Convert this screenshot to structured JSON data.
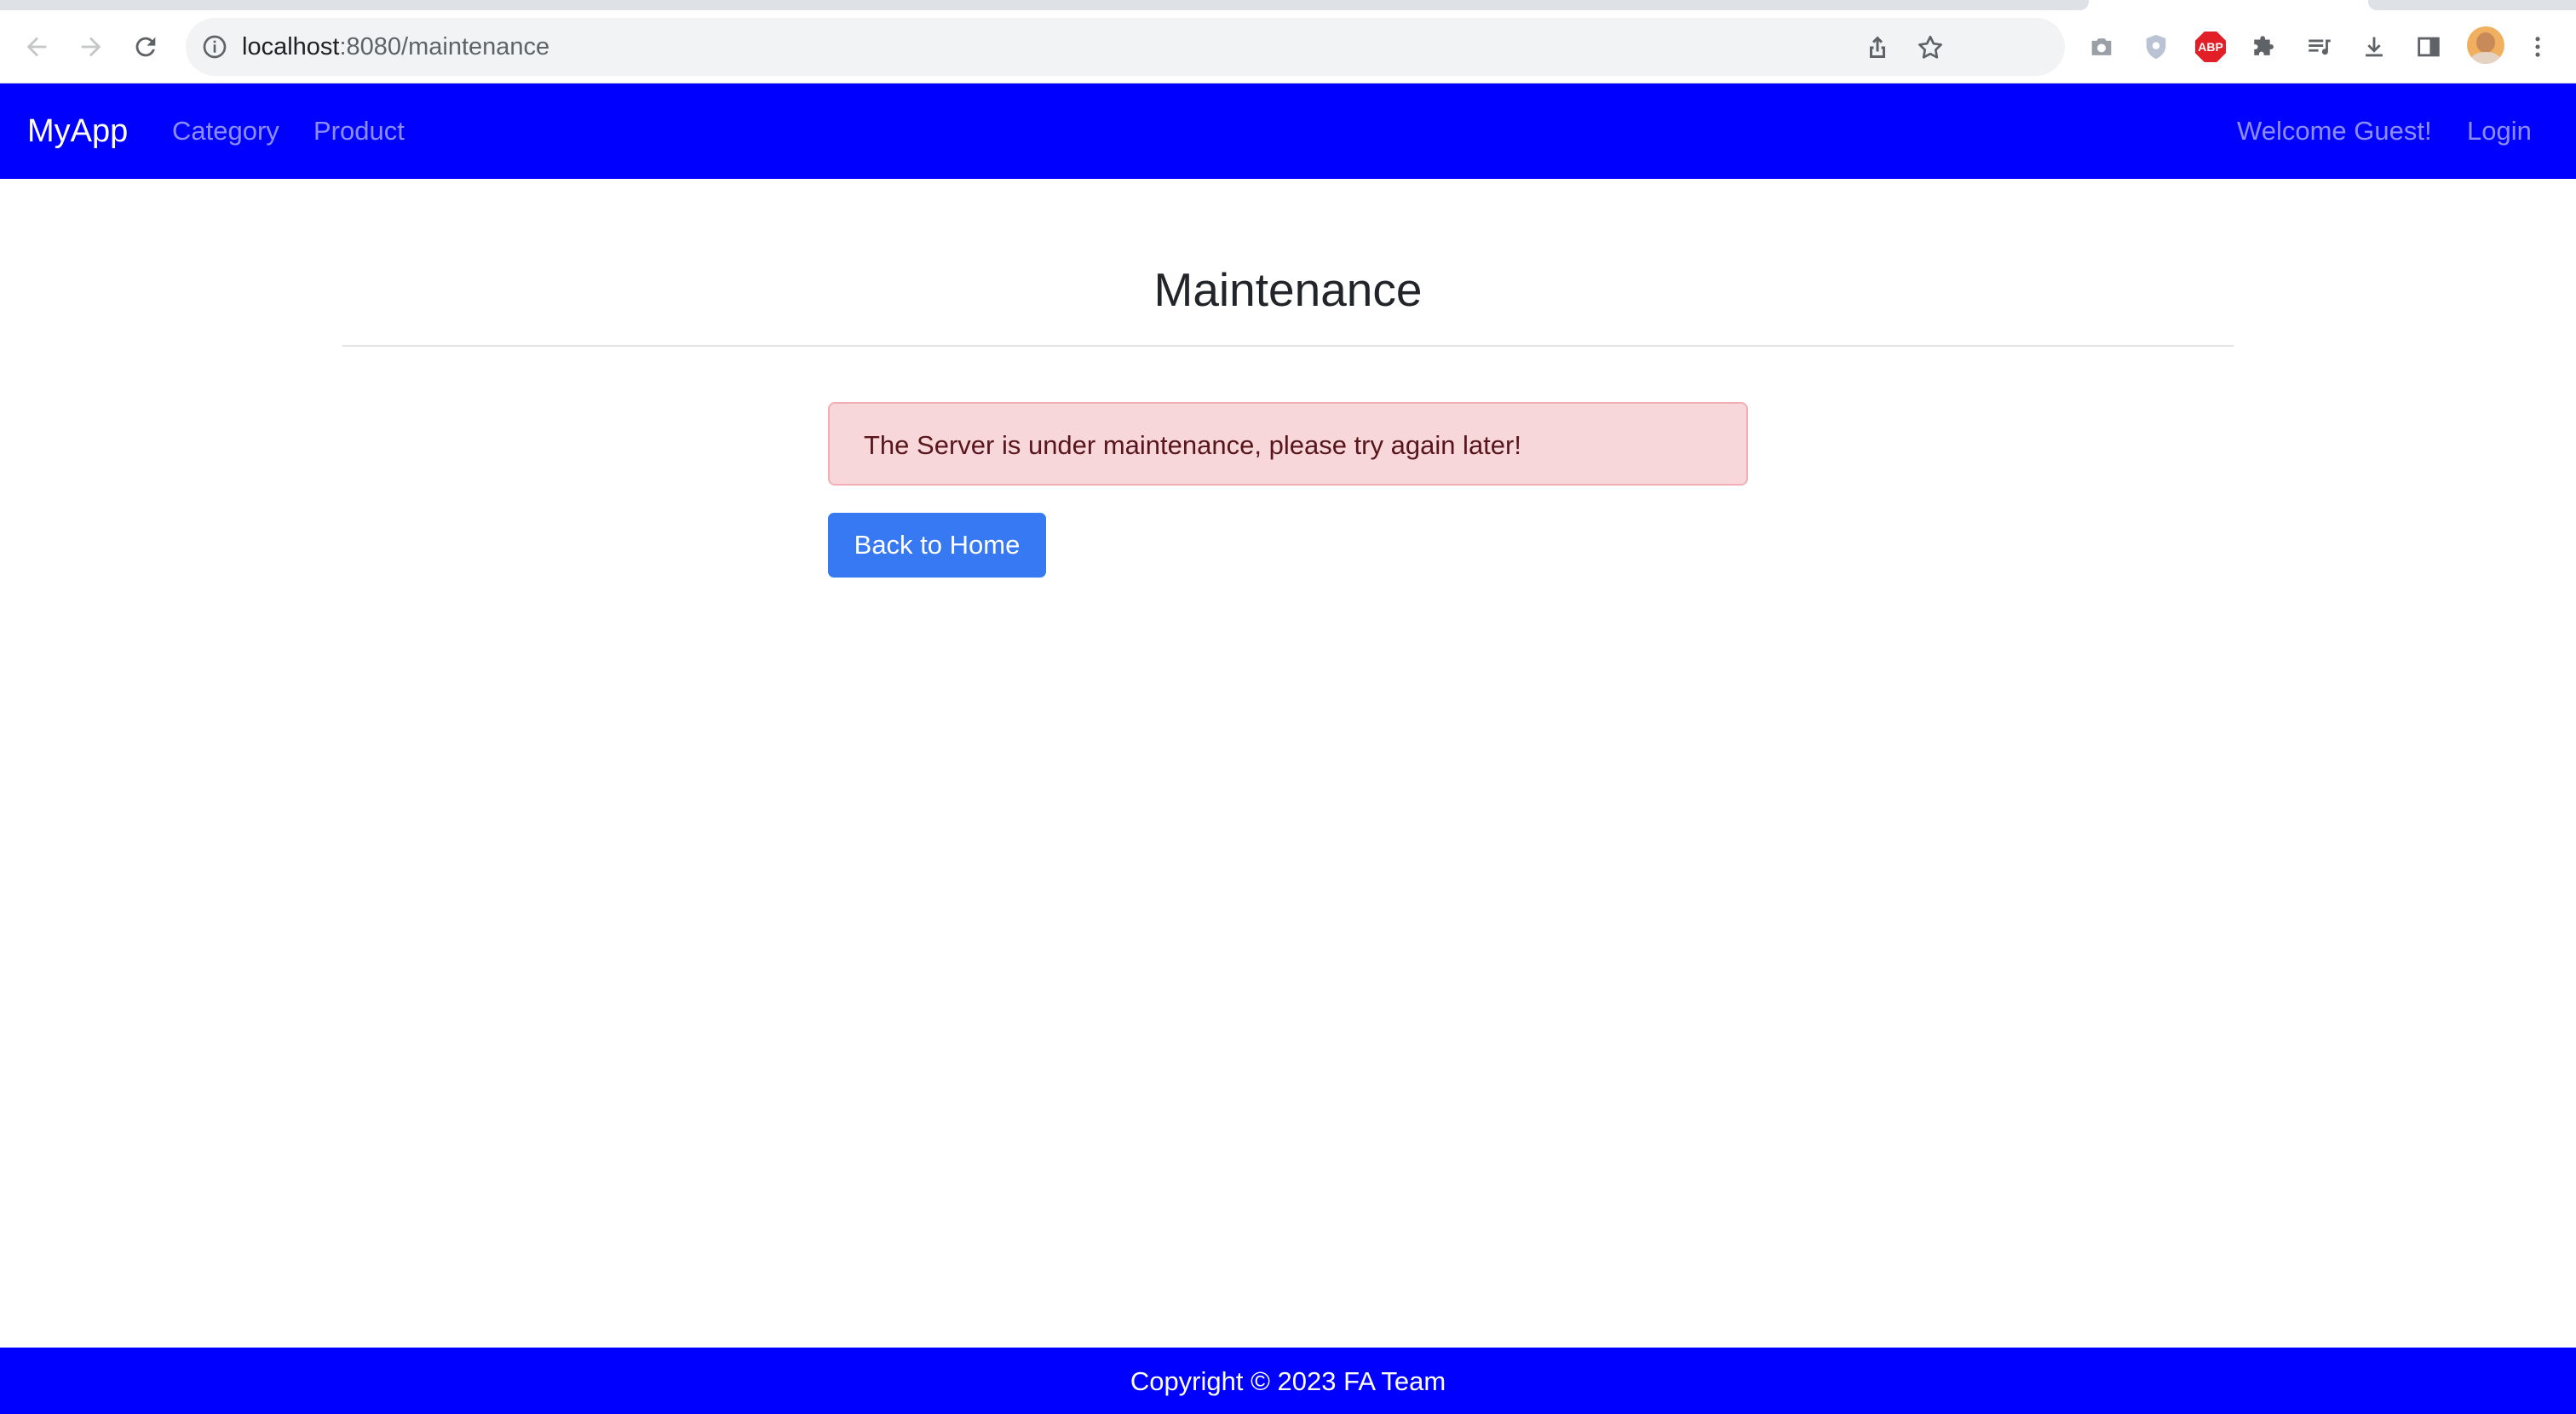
{
  "browser": {
    "url_host": "localhost",
    "url_path": ":8080/maintenance",
    "icons": [
      "back-icon",
      "forward-icon",
      "reload-icon",
      "info-icon",
      "share-icon",
      "bookmark-star-icon",
      "camera-icon",
      "shield-extension-icon",
      "adblock-icon",
      "extensions-puzzle-icon",
      "media-queue-icon",
      "download-icon",
      "side-panel-icon",
      "profile-avatar",
      "more-menu-icon"
    ],
    "adblock_label": "ABP"
  },
  "navbar": {
    "brand": "MyApp",
    "links": [
      "Category",
      "Product"
    ],
    "welcome": "Welcome Guest!",
    "login": "Login",
    "color": "#0000ff"
  },
  "main": {
    "title": "Maintenance",
    "alert": "The Server is under maintenance, please try again later!",
    "button": "Back to Home"
  },
  "footer": {
    "text": "Copyright © 2023 FA Team"
  },
  "colors": {
    "accent": "#0000ff",
    "button": "#3679f2",
    "alert_bg": "#f8d7da",
    "alert_text": "#58151c"
  }
}
